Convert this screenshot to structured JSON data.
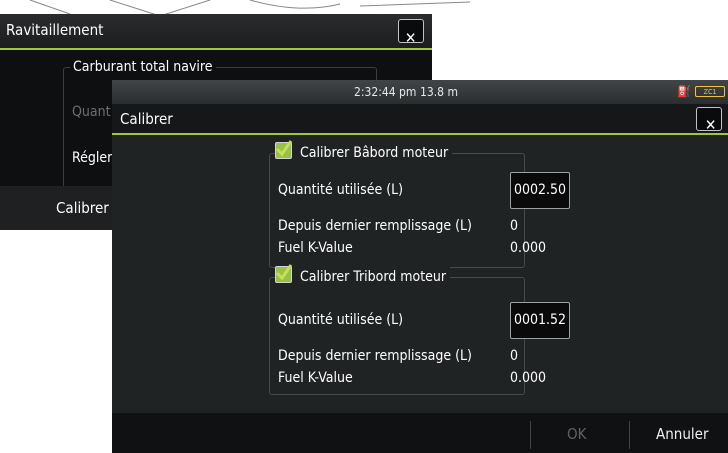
{
  "back_dialog": {
    "title": "Ravitaillement",
    "close_glyph": "✕",
    "group_label": "Carburant total navire",
    "quantity_label": "Quant",
    "set_label": "Régler",
    "calibrate_button": "Calibrer"
  },
  "front_dialog": {
    "status": {
      "time": "2:32:44 pm",
      "depth": "13.8 m",
      "fuel_icon": "fuel-pump-icon",
      "zc_badge": "ZC1"
    },
    "title": "Calibrer",
    "close_glyph": "✕",
    "port": {
      "label": "Calibrer Bâbord moteur",
      "checked": true,
      "used_label": "Quantité utilisée (L)",
      "used_value": "0002.50",
      "since_fill_label": "Depuis dernier remplissage (L)",
      "since_fill_value": "0",
      "k_label": "Fuel K-Value",
      "k_value": "0.000"
    },
    "starboard": {
      "label": "Calibrer Tribord moteur",
      "checked": true,
      "used_label": "Quantité utilisée (L)",
      "used_value": "0001.52",
      "since_fill_label": "Depuis dernier remplissage (L)",
      "since_fill_value": "0",
      "k_label": "Fuel K-Value",
      "k_value": "0.000"
    },
    "ok_button": "OK",
    "cancel_button": "Annuler"
  },
  "colors": {
    "accent": "#a2c83a",
    "checkbox": "#99c243",
    "disabled_text": "#5e6366",
    "status_icon": "#f0c23c"
  }
}
